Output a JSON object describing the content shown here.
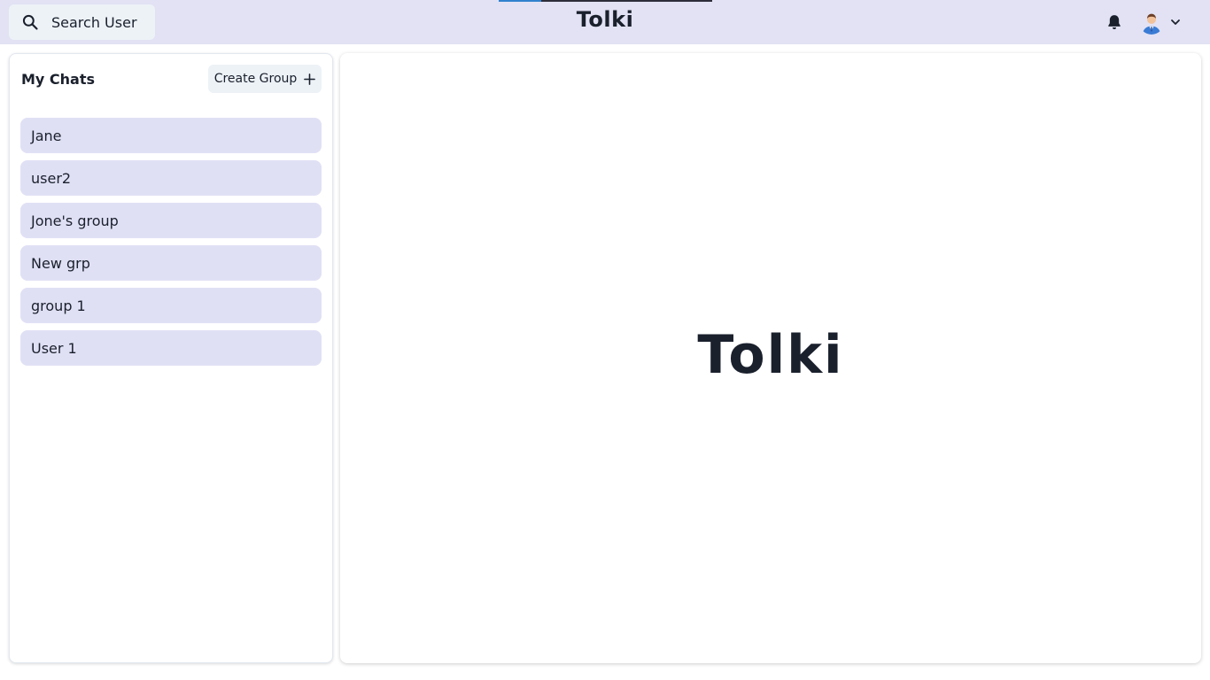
{
  "header": {
    "search_label": "Search User",
    "app_title": "Tolki",
    "icons": {
      "search": "search-icon",
      "bell": "bell-icon",
      "avatar": "avatar",
      "chevron": "chevron-down-icon"
    },
    "colors": {
      "background": "#e2e2f4",
      "loader_accent": "#3182ce"
    }
  },
  "sidebar": {
    "title": "My Chats",
    "create_group_label": "Create Group",
    "chats": [
      {
        "label": "Jane"
      },
      {
        "label": "user2"
      },
      {
        "label": "Jone's group"
      },
      {
        "label": "New grp"
      },
      {
        "label": "group 1"
      },
      {
        "label": "User 1"
      }
    ],
    "colors": {
      "chat_item_bg": "#e0e0f5"
    }
  },
  "main": {
    "placeholder_title": "Tolki"
  }
}
